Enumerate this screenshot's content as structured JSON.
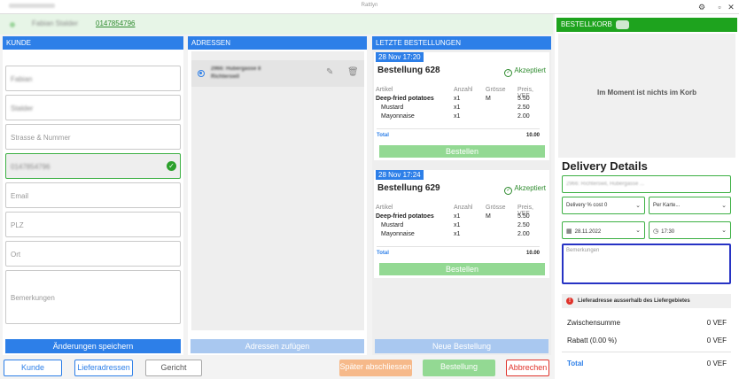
{
  "window": {
    "title": "Rattlyn",
    "settings_icon": "gear-icon",
    "close_icon": "close-icon"
  },
  "top_info": {
    "name": "Fabian Stalder",
    "phone": "0147854796"
  },
  "kunde": {
    "header": "KUNDE",
    "fields": {
      "first_name": "Fabian",
      "last_name": "Stalder",
      "street": "Strasse & Nummer",
      "phone": "0147854796",
      "email": "Email",
      "plz": "PLZ",
      "ort": "Ort",
      "notes": "Bemerkungen"
    },
    "save_button": "Änderungen speichern"
  },
  "adressen": {
    "header": "ADRESSEN",
    "items": [
      {
        "line1": "2966: Hubergasse 8",
        "line2": "Richterswil"
      }
    ],
    "add_button": "Adressen zufügen"
  },
  "bestellungen": {
    "header": "LETZTE BESTELLUNGEN",
    "columns": [
      "Artikel",
      "Anzahl",
      "Grösse",
      "Preis, VEF"
    ],
    "orders": [
      {
        "date": "28 Nov 17:20",
        "title": "Bestellung 628",
        "status": "Akzeptiert",
        "items": [
          {
            "name": "Deep-fried potatoes",
            "qty": "x1",
            "size": "M",
            "price": "5.50"
          },
          {
            "name": "Mustard",
            "qty": "x1",
            "size": "",
            "price": "2.50"
          },
          {
            "name": "Mayonnaise",
            "qty": "x1",
            "size": "",
            "price": "2.00"
          }
        ],
        "total_label": "Total",
        "total": "10.00",
        "order_button": "Bestellen"
      },
      {
        "date": "28 Nov 17:24",
        "title": "Bestellung 629",
        "status": "Akzeptiert",
        "items": [
          {
            "name": "Deep-fried potatoes",
            "qty": "x1",
            "size": "M",
            "price": "5.50"
          },
          {
            "name": "Mustard",
            "qty": "x1",
            "size": "",
            "price": "2.50"
          },
          {
            "name": "Mayonnaise",
            "qty": "x1",
            "size": "",
            "price": "2.00"
          }
        ],
        "total_label": "Total",
        "total": "10.00",
        "order_button": "Bestellen"
      }
    ],
    "new_button": "Neue Bestellung"
  },
  "bottom_bar": {
    "tabs": [
      "Kunde",
      "Lieferadressen",
      "Gericht"
    ],
    "later": "Später abschliessen",
    "order": "Bestellung",
    "cancel": "Abbrechen"
  },
  "cart": {
    "header": "BESTELLKORB",
    "empty_text": "Im Moment ist nichts im Korb",
    "delivery_title": "Delivery Details",
    "address_value": "2966: Richterswil, Hubergasse ...",
    "delivery_select": "Delivery % cost 0",
    "payment_select": "Per Karte...",
    "date": "28.11.2022",
    "time": "17:30",
    "notes_placeholder": "Bemerkungen",
    "warning": "Lieferadresse ausserhalb des Liefergebietes",
    "subtotal_label": "Zwischensumme",
    "subtotal_value": "0 VEF",
    "discount_label": "Rabatt (0.00 %)",
    "discount_value": "0 VEF",
    "total_label": "Total",
    "total_value": "0 VEF"
  },
  "colors": {
    "accent_blue": "#2d7fe8",
    "green": "#3cb043",
    "header_green": "#1ea31e",
    "disabled_green": "#93d993",
    "orange": "#f6b98a",
    "red": "#e0332b"
  }
}
